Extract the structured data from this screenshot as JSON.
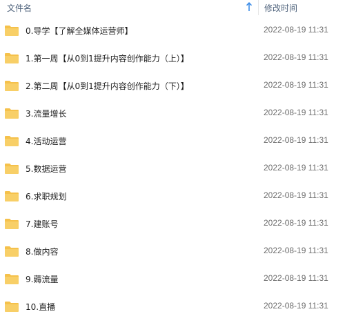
{
  "header": {
    "name_label": "文件名",
    "date_label": "修改时间",
    "sort_icon": "arrow-up-icon",
    "accent_color": "#3c8ce7"
  },
  "folder_color": "#f5c14b",
  "files": [
    {
      "name": "0.导学【了解全媒体运营师】",
      "date": "2022-08-19 11:31"
    },
    {
      "name": "1.第一周【从0到1提升内容创作能力（上）】",
      "date": "2022-08-19 11:31"
    },
    {
      "name": "2.第二周【从0到1提升内容创作能力（下）】",
      "date": "2022-08-19 11:31"
    },
    {
      "name": "3.流量增长",
      "date": "2022-08-19 11:31"
    },
    {
      "name": "4.活动运营",
      "date": "2022-08-19 11:31"
    },
    {
      "name": "5.数据运营",
      "date": "2022-08-19 11:31"
    },
    {
      "name": "6.求职规划",
      "date": "2022-08-19 11:31"
    },
    {
      "name": "7.建账号",
      "date": "2022-08-19 11:31"
    },
    {
      "name": "8.做内容",
      "date": "2022-08-19 11:31"
    },
    {
      "name": "9.薅流量",
      "date": "2022-08-19 11:31"
    },
    {
      "name": "10.直播",
      "date": "2022-08-19 11:31"
    }
  ]
}
